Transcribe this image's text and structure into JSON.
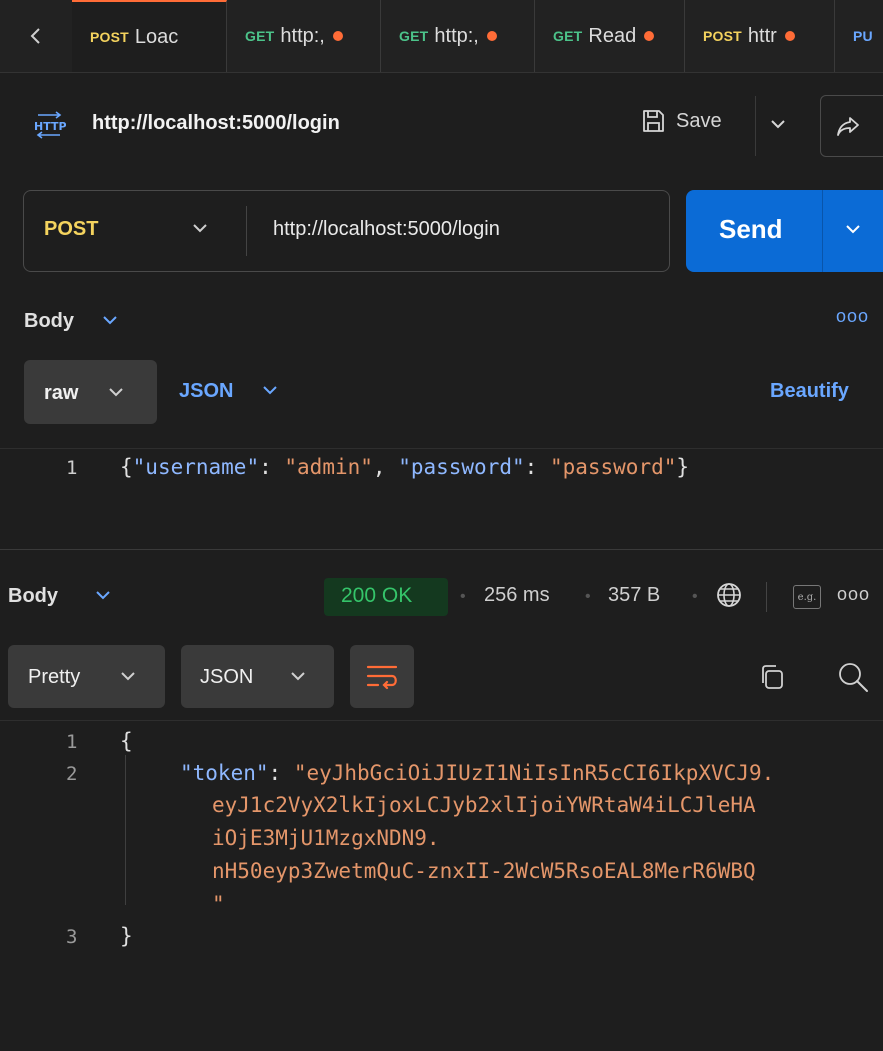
{
  "tabs": [
    {
      "method": "POST",
      "method_color": "#f4d35e",
      "label": "Loac",
      "unsaved": false,
      "active": true
    },
    {
      "method": "GET",
      "method_color": "#4cc38a",
      "label": "http:,",
      "unsaved": true,
      "active": false
    },
    {
      "method": "GET",
      "method_color": "#4cc38a",
      "label": "http:,",
      "unsaved": true,
      "active": false
    },
    {
      "method": "GET",
      "method_color": "#4cc38a",
      "label": "Read",
      "unsaved": true,
      "active": false
    },
    {
      "method": "POST",
      "method_color": "#f4d35e",
      "label": "httr",
      "unsaved": true,
      "active": false
    },
    {
      "method": "PU",
      "method_color": "#6aa7ff",
      "label": "",
      "unsaved": false,
      "active": false
    }
  ],
  "request": {
    "icon_text": "HTTP",
    "title": "http://localhost:5000/login",
    "save_label": "Save",
    "method": "POST",
    "url": "http://localhost:5000/login",
    "send_label": "Send"
  },
  "body": {
    "label": "Body",
    "mode": "raw",
    "format": "JSON",
    "beautify_label": "Beautify",
    "more": "ooo",
    "editor": {
      "line_number": "1",
      "tokens": [
        "{",
        "\"username\"",
        ": ",
        "\"admin\"",
        ", ",
        "\"password\"",
        ": ",
        "\"password\"",
        "}"
      ]
    }
  },
  "response": {
    "label": "Body",
    "status": "200 OK",
    "time": "256 ms",
    "size": "357 B",
    "eg_label": "e.g.",
    "more": "ooo",
    "view": "Pretty",
    "format": "JSON",
    "lines": {
      "n1": "1",
      "open": "{",
      "n2": "2",
      "key": "\"token\"",
      "colon": ": ",
      "token_parts": [
        "\"eyJhbGciOiJIUzI1NiIsInR5cCI6IkpXVCJ9.",
        "eyJ1c2VyX2lkIjoxLCJyb2xlIjoiYWRtaW4iLCJleHA",
        "iOjE3MjU1MzgxNDN9.",
        "nH50eyp3ZwetmQuC-znxII-2WcW5RsoEAL8MerR6WBQ",
        "\""
      ],
      "n3": "3",
      "close": "}"
    }
  },
  "colors": {
    "accent_send": "#0b6bd6",
    "link_blue": "#6aa7ff",
    "status_green": "#35c46a",
    "post_yellow": "#f4d35e"
  }
}
